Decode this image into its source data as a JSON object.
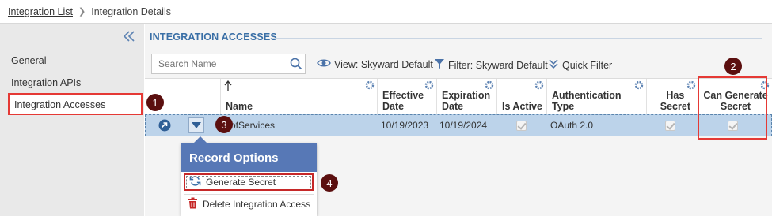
{
  "breadcrumb": {
    "root": "Integration List",
    "current": "Integration Details"
  },
  "sidebar": {
    "collapse_icon": "double-chevron-left-icon",
    "items": [
      {
        "label": "General"
      },
      {
        "label": "Integration APIs"
      },
      {
        "label": "Integration Accesses"
      }
    ]
  },
  "main": {
    "section_title": "INTEGRATION ACCESSES",
    "search": {
      "placeholder": "Search Name",
      "icon": "search-icon"
    },
    "toolbar": {
      "view_label": "View: Skyward Default",
      "filter_label": "Filter: Skyward Default",
      "quick_filter_label": "Quick Filter"
    },
    "grid": {
      "columns": [
        {
          "label": "Name",
          "sort": "ascending"
        },
        {
          "label_line1": "Effective",
          "label_line2": "Date"
        },
        {
          "label_line1": "Expiration",
          "label_line2": "Date"
        },
        {
          "label": "Is Active"
        },
        {
          "label": "Authentication Type"
        },
        {
          "label_line1": "Has",
          "label_line2": "Secret"
        },
        {
          "label_line1": "Can Generate",
          "label_line2": "Secret"
        }
      ],
      "row": {
        "name": "ofServices",
        "effective_date": "10/19/2023",
        "expiration_date": "10/19/2024",
        "is_active": true,
        "authentication_type": "OAuth 2.0",
        "has_secret": true,
        "can_generate_secret": true
      }
    }
  },
  "popup": {
    "title": "Record Options",
    "options": [
      {
        "label": "Generate Secret",
        "icon": "refresh-icon"
      },
      {
        "label": "Delete Integration Access",
        "icon": "trash-icon"
      }
    ]
  },
  "callouts": [
    "1",
    "2",
    "3",
    "4"
  ],
  "colors": {
    "accent": "#3a6fa6",
    "highlight": "#e53935",
    "row_selected": "#bcd3ea",
    "popup_header": "#5778b6",
    "callout": "#5b0f0f"
  }
}
